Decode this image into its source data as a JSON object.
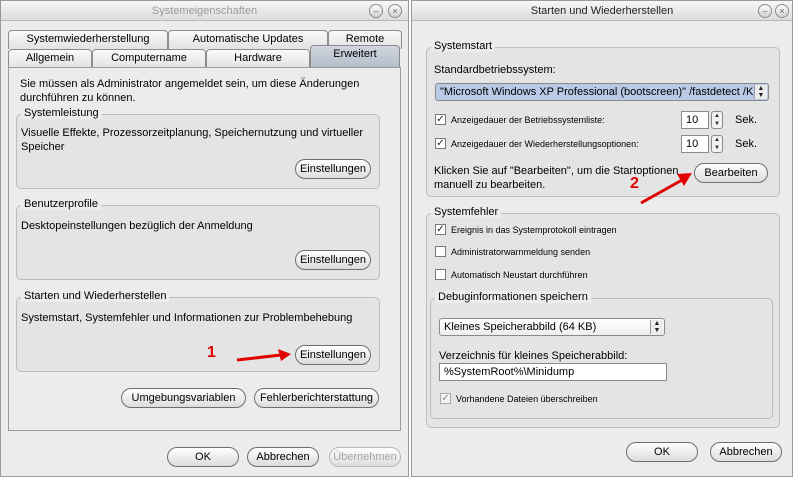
{
  "left_window": {
    "title": "Systemeigenschaften",
    "tabs_back": [
      "Systemwiederherstellung",
      "Automatische Updates",
      "Remote"
    ],
    "tabs_front": [
      "Allgemein",
      "Computername",
      "Hardware",
      "Erweitert"
    ],
    "admin_note_line1": "Sie müssen als Administrator angemeldet sein, um diese Änderungen",
    "admin_note_line2": "durchführen zu können.",
    "performance": {
      "legend": "Systemleistung",
      "desc_line1": "Visuelle Effekte, Prozessorzeitplanung, Speichernutzung und virtueller",
      "desc_line2": "Speicher",
      "button": "Einstellungen"
    },
    "profiles": {
      "legend": "Benutzerprofile",
      "desc": "Desktopeinstellungen bezüglich der Anmeldung",
      "button": "Einstellungen"
    },
    "startup": {
      "legend": "Starten und Wiederherstellen",
      "desc": "Systemstart, Systemfehler und Informationen zur Problembehebung",
      "button": "Einstellungen"
    },
    "env_button": "Umgebungsvariablen",
    "error_report_button": "Fehlerberichterstattung",
    "ok": "OK",
    "cancel": "Abbrechen",
    "apply": "Übernehmen"
  },
  "right_window": {
    "title": "Starten und Wiederherstellen",
    "system_start": {
      "legend": "Systemstart",
      "default_os_label": "Standardbetriebssystem:",
      "default_os_value": "\"Microsoft Windows XP Professional (bootscreen)\" /fastdetect /KE",
      "os_list_label": "Anzeigedauer der Betriebssystemliste:",
      "os_list_seconds": "10",
      "recovery_label": "Anzeigedauer der Wiederherstellungsoptionen:",
      "recovery_seconds": "10",
      "unit": "Sek.",
      "edit_hint_line1": "Klicken Sie auf \"Bearbeiten\", um die Startoptionen",
      "edit_hint_line2": "manuell zu bearbeiten.",
      "edit_button": "Bearbeiten"
    },
    "system_failure": {
      "legend": "Systemfehler",
      "log_event": "Ereignis in das Systemprotokoll eintragen",
      "send_alert": "Administratorwarnmeldung senden",
      "auto_restart": "Automatisch Neustart durchführen"
    },
    "debug": {
      "legend": "Debuginformationen speichern",
      "dump_type": "Kleines Speicherabbild (64 KB)",
      "dir_label": "Verzeichnis für kleines Speicherabbild:",
      "dir_value": "%SystemRoot%\\Minidump",
      "overwrite": "Vorhandene Dateien überschreiben"
    },
    "ok": "OK",
    "cancel": "Abbrechen"
  },
  "markers": {
    "one": "1",
    "two": "2"
  },
  "colors": {
    "arrow": "#e00000",
    "active_tab": "#b4bcc8"
  }
}
